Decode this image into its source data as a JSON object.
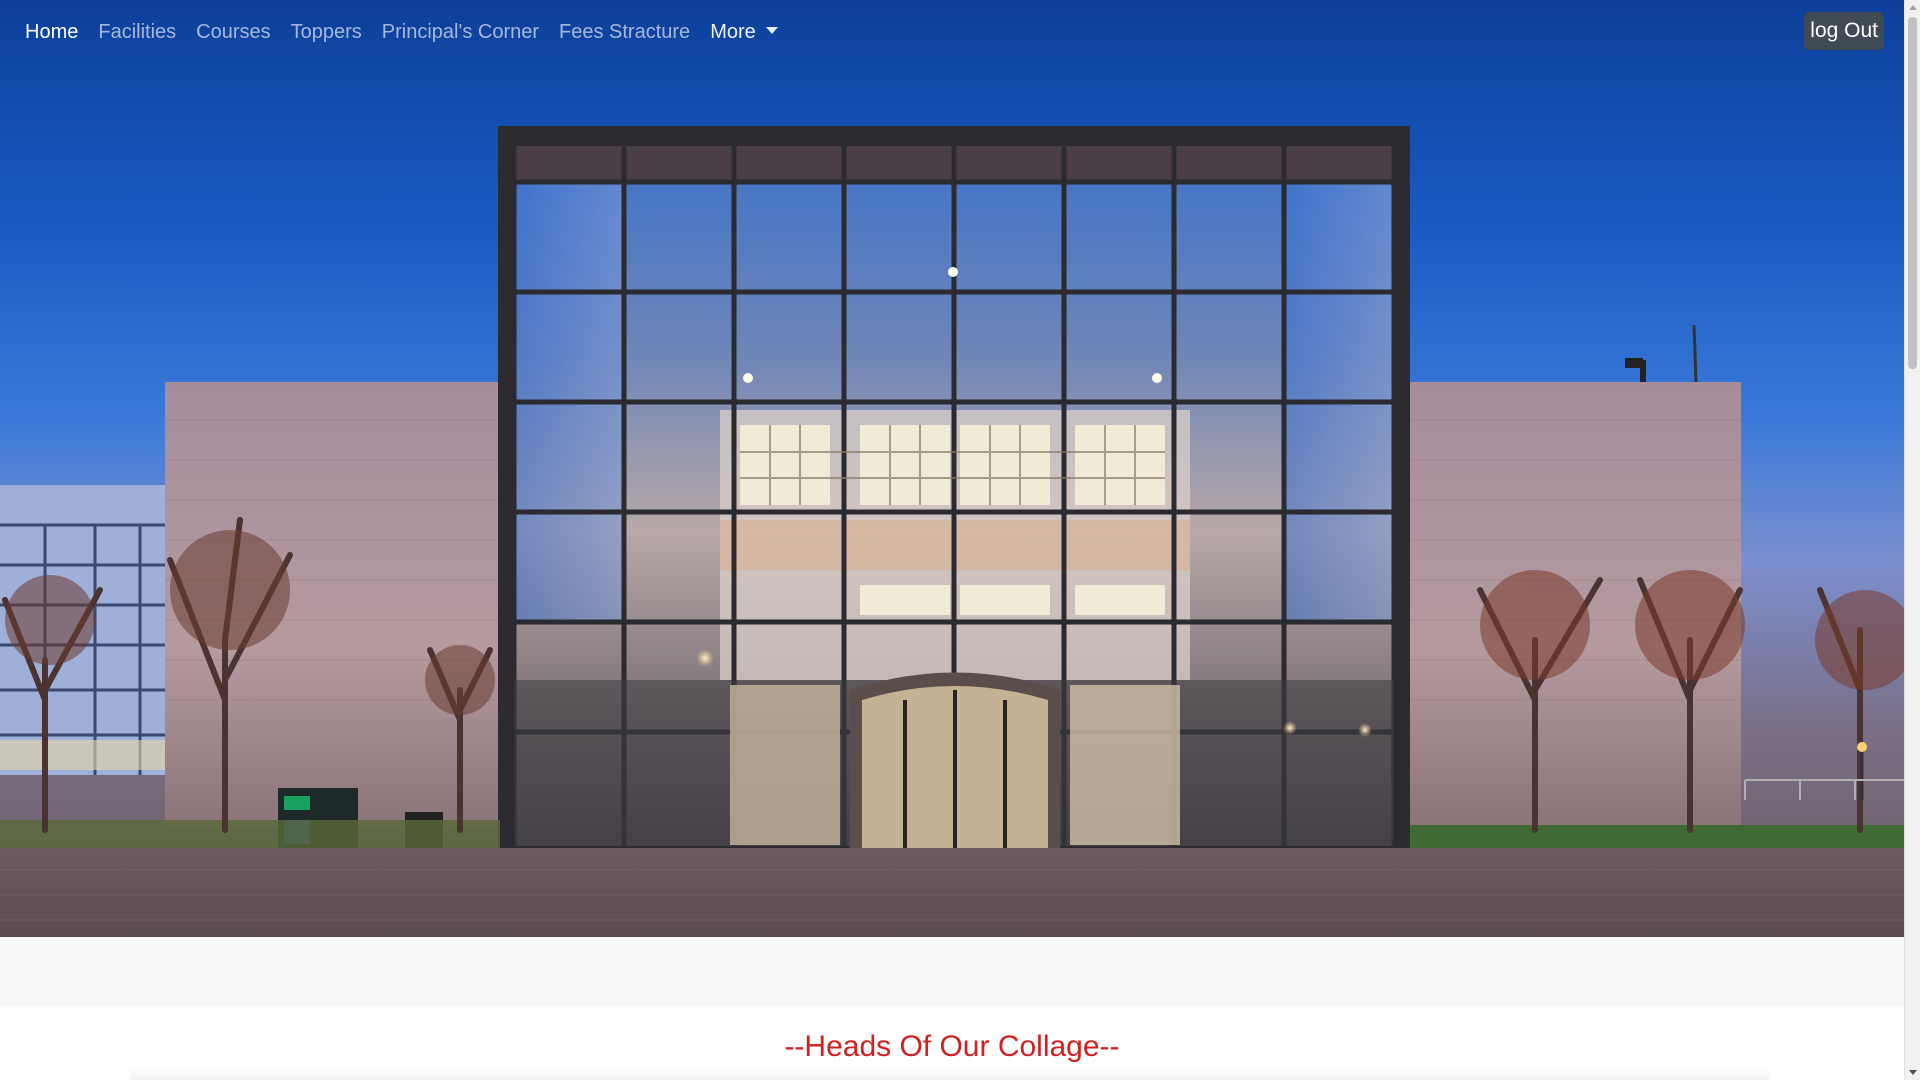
{
  "navbar": {
    "links": [
      {
        "label": "Home",
        "active": true
      },
      {
        "label": "Facilities",
        "active": false
      },
      {
        "label": "Courses",
        "active": false
      },
      {
        "label": "Toppers",
        "active": false
      },
      {
        "label": "Principal's Corner",
        "active": false
      },
      {
        "label": "Fees Stracture",
        "active": false
      }
    ],
    "more_label": "More",
    "logout_label": "log Out"
  },
  "hero": {
    "image": "college-building-photo"
  },
  "section": {
    "title": "--Heads Of Our Collage--"
  },
  "colors": {
    "title_red": "#d02020",
    "nav_active": "#ffffff",
    "nav_inactive": "rgba(255,255,255,0.62)",
    "logout_bg": "#3f4a55"
  }
}
